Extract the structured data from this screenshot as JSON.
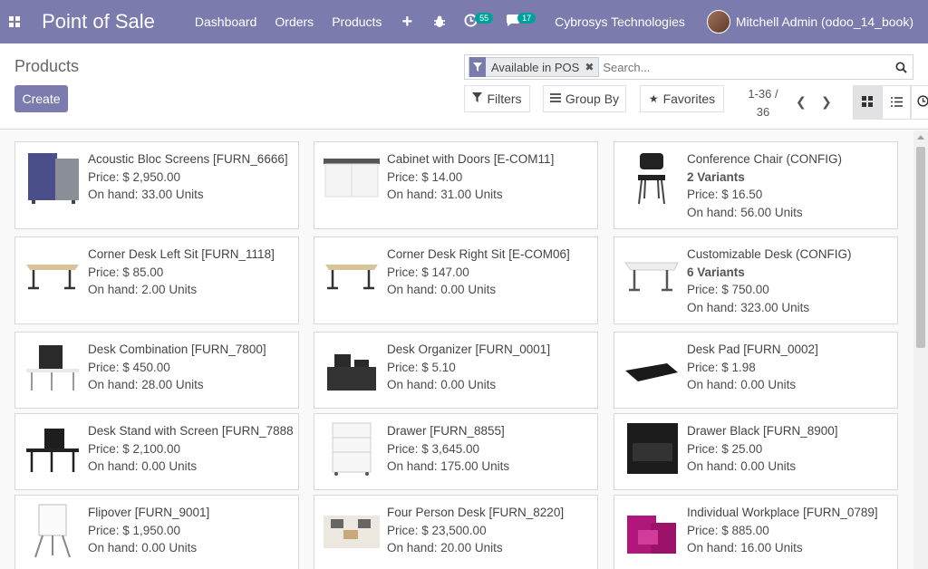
{
  "navbar": {
    "app_title": "Point of Sale",
    "menu": [
      "Dashboard",
      "Orders",
      "Products"
    ],
    "plus": "+",
    "activity_count": "55",
    "message_count": "17",
    "company": "Cybrosys Technologies",
    "user": "Mitchell Admin (odoo_14_book)"
  },
  "control_panel": {
    "title": "Products",
    "create_label": "Create",
    "facet_label": "Available in POS",
    "facet_close": "✖",
    "search_placeholder": "Search...",
    "filters_label": "Filters",
    "groupby_label": "Group By",
    "favorites_label": "Favorites",
    "pager_range": "1-36 /",
    "pager_total": "36"
  },
  "products": [
    {
      "name": "Acoustic Bloc Screens [FURN_6666]",
      "variants": "",
      "price": "Price: $ 2,950.00",
      "onhand": "On hand: 33.00 Units",
      "icon": "acoustic-screen-icon"
    },
    {
      "name": "Cabinet with Doors [E-COM11]",
      "variants": "",
      "price": "Price: $ 14.00",
      "onhand": "On hand: 31.00 Units",
      "icon": "cabinet-icon"
    },
    {
      "name": "Conference Chair (CONFIG)",
      "variants": "2 Variants",
      "price": "Price: $ 16.50",
      "onhand": "On hand: 56.00 Units",
      "icon": "chair-icon"
    },
    {
      "name": "Corner Desk Left Sit [FURN_1118]",
      "variants": "",
      "price": "Price: $ 85.00",
      "onhand": "On hand: 2.00 Units",
      "icon": "corner-desk-icon"
    },
    {
      "name": "Corner Desk Right Sit [E-COM06]",
      "variants": "",
      "price": "Price: $ 147.00",
      "onhand": "On hand: 0.00 Units",
      "icon": "corner-desk-icon"
    },
    {
      "name": "Customizable Desk (CONFIG)",
      "variants": "6 Variants",
      "price": "Price: $ 750.00",
      "onhand": "On hand: 323.00 Units",
      "icon": "desk-icon"
    },
    {
      "name": "Desk Combination [FURN_7800]",
      "variants": "",
      "price": "Price: $ 450.00",
      "onhand": "On hand: 28.00 Units",
      "icon": "desk-combination-icon"
    },
    {
      "name": "Desk Organizer [FURN_0001]",
      "variants": "",
      "price": "Price: $ 5.10",
      "onhand": "On hand: 0.00 Units",
      "icon": "desk-organizer-icon"
    },
    {
      "name": "Desk Pad [FURN_0002]",
      "variants": "",
      "price": "Price: $ 1.98",
      "onhand": "On hand: 0.00 Units",
      "icon": "desk-pad-icon"
    },
    {
      "name": "Desk Stand with Screen [FURN_7888]",
      "variants": "",
      "price": "Price: $ 2,100.00",
      "onhand": "On hand: 0.00 Units",
      "icon": "desk-stand-icon"
    },
    {
      "name": "Drawer [FURN_8855]",
      "variants": "",
      "price": "Price: $ 3,645.00",
      "onhand": "On hand: 175.00 Units",
      "icon": "drawer-icon"
    },
    {
      "name": "Drawer Black [FURN_8900]",
      "variants": "",
      "price": "Price: $ 25.00",
      "onhand": "On hand: 0.00 Units",
      "icon": "drawer-black-icon"
    },
    {
      "name": "Flipover [FURN_9001]",
      "variants": "",
      "price": "Price: $ 1,950.00",
      "onhand": "On hand: 0.00 Units",
      "icon": "flipover-icon"
    },
    {
      "name": "Four Person Desk [FURN_8220]",
      "variants": "",
      "price": "Price: $ 23,500.00",
      "onhand": "On hand: 20.00 Units",
      "icon": "four-person-desk-icon"
    },
    {
      "name": "Individual Workplace [FURN_0789]",
      "variants": "",
      "price": "Price: $ 885.00",
      "onhand": "On hand: 16.00 Units",
      "icon": "workplace-icon"
    }
  ],
  "colors": {
    "brand": "#7c7bad",
    "badge": "#00a09d"
  }
}
